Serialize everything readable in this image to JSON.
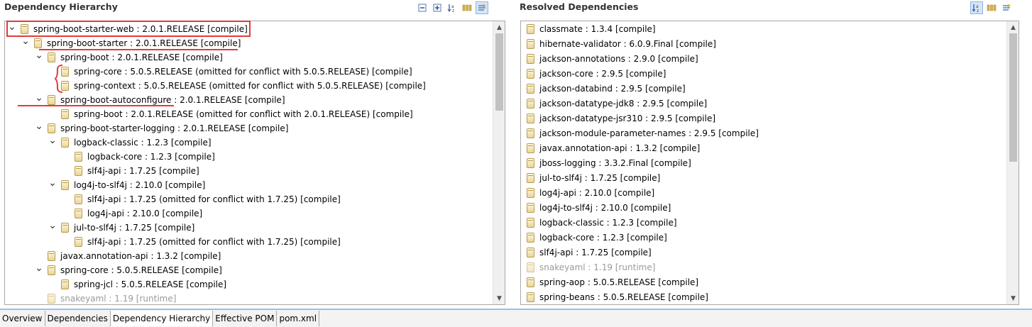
{
  "left_panel": {
    "title": "Dependency Hierarchy",
    "toolbar": [
      "collapse-all-icon",
      "expand-all-icon",
      "sort-az-icon",
      "show-groupid-icon",
      "filter-icon"
    ],
    "rows": [
      {
        "indent": 0,
        "expand": "open",
        "text": "spring-boot-starter-web : 2.0.1.RELEASE [compile]",
        "grey": false
      },
      {
        "indent": 1,
        "expand": "open",
        "text": "spring-boot-starter : 2.0.1.RELEASE [compile]",
        "grey": false
      },
      {
        "indent": 2,
        "expand": "open",
        "text": "spring-boot : 2.0.1.RELEASE [compile]",
        "grey": false
      },
      {
        "indent": 3,
        "expand": "none",
        "text": "spring-core : 5.0.5.RELEASE (omitted for conflict with 5.0.5.RELEASE) [compile]",
        "grey": false
      },
      {
        "indent": 3,
        "expand": "none",
        "text": "spring-context : 5.0.5.RELEASE (omitted for conflict with 5.0.5.RELEASE) [compile]",
        "grey": false
      },
      {
        "indent": 2,
        "expand": "open",
        "text": "spring-boot-autoconfigure : 2.0.1.RELEASE [compile]",
        "grey": false
      },
      {
        "indent": 3,
        "expand": "none",
        "text": "spring-boot : 2.0.1.RELEASE (omitted for conflict with 2.0.1.RELEASE) [compile]",
        "grey": false
      },
      {
        "indent": 2,
        "expand": "open",
        "text": "spring-boot-starter-logging : 2.0.1.RELEASE [compile]",
        "grey": false
      },
      {
        "indent": 3,
        "expand": "open",
        "text": "logback-classic : 1.2.3 [compile]",
        "grey": false
      },
      {
        "indent": 4,
        "expand": "none",
        "text": "logback-core : 1.2.3 [compile]",
        "grey": false
      },
      {
        "indent": 4,
        "expand": "none",
        "text": "slf4j-api : 1.7.25 [compile]",
        "grey": false
      },
      {
        "indent": 3,
        "expand": "open",
        "text": "log4j-to-slf4j : 2.10.0 [compile]",
        "grey": false
      },
      {
        "indent": 4,
        "expand": "none",
        "text": "slf4j-api : 1.7.25 (omitted for conflict with 1.7.25) [compile]",
        "grey": false
      },
      {
        "indent": 4,
        "expand": "none",
        "text": "log4j-api : 2.10.0 [compile]",
        "grey": false
      },
      {
        "indent": 3,
        "expand": "open",
        "text": "jul-to-slf4j : 1.7.25 [compile]",
        "grey": false
      },
      {
        "indent": 4,
        "expand": "none",
        "text": "slf4j-api : 1.7.25 (omitted for conflict with 1.7.25) [compile]",
        "grey": false
      },
      {
        "indent": 2,
        "expand": "none",
        "text": "javax.annotation-api : 1.3.2 [compile]",
        "grey": false
      },
      {
        "indent": 2,
        "expand": "open",
        "text": "spring-core : 5.0.5.RELEASE [compile]",
        "grey": false
      },
      {
        "indent": 3,
        "expand": "none",
        "text": "spring-jcl : 5.0.5.RELEASE [compile]",
        "grey": false
      },
      {
        "indent": 2,
        "expand": "none",
        "text": "snakeyaml : 1.19 [runtime]",
        "grey": true
      }
    ]
  },
  "right_panel": {
    "title": "Resolved Dependencies",
    "toolbar": [
      "sort-az-icon",
      "show-groupid-icon",
      "filter-icon"
    ],
    "rows": [
      {
        "text": "classmate : 1.3.4 [compile]",
        "grey": false
      },
      {
        "text": "hibernate-validator : 6.0.9.Final [compile]",
        "grey": false
      },
      {
        "text": "jackson-annotations : 2.9.0 [compile]",
        "grey": false
      },
      {
        "text": "jackson-core : 2.9.5 [compile]",
        "grey": false
      },
      {
        "text": "jackson-databind : 2.9.5 [compile]",
        "grey": false
      },
      {
        "text": "jackson-datatype-jdk8 : 2.9.5 [compile]",
        "grey": false
      },
      {
        "text": "jackson-datatype-jsr310 : 2.9.5 [compile]",
        "grey": false
      },
      {
        "text": "jackson-module-parameter-names : 2.9.5 [compile]",
        "grey": false
      },
      {
        "text": "javax.annotation-api : 1.3.2 [compile]",
        "grey": false
      },
      {
        "text": "jboss-logging : 3.3.2.Final [compile]",
        "grey": false
      },
      {
        "text": "jul-to-slf4j : 1.7.25 [compile]",
        "grey": false
      },
      {
        "text": "log4j-api : 2.10.0 [compile]",
        "grey": false
      },
      {
        "text": "log4j-to-slf4j : 2.10.0 [compile]",
        "grey": false
      },
      {
        "text": "logback-classic : 1.2.3 [compile]",
        "grey": false
      },
      {
        "text": "logback-core : 1.2.3 [compile]",
        "grey": false
      },
      {
        "text": "slf4j-api : 1.7.25 [compile]",
        "grey": false
      },
      {
        "text": "snakeyaml : 1.19 [runtime]",
        "grey": true
      },
      {
        "text": "spring-aop : 5.0.5.RELEASE [compile]",
        "grey": false
      },
      {
        "text": "spring-beans : 5.0.5.RELEASE [compile]",
        "grey": false
      }
    ]
  },
  "bottom_tabs": [
    {
      "label": "Overview",
      "active": false
    },
    {
      "label": "Dependencies",
      "active": false
    },
    {
      "label": "Dependency Hierarchy",
      "active": true
    },
    {
      "label": "Effective POM",
      "active": false
    },
    {
      "label": "pom.xml",
      "active": false
    }
  ],
  "colors": {
    "annotation": "#e23a3a",
    "tab_border": "#9dbce8",
    "grey_text": "#9a9a9a"
  }
}
